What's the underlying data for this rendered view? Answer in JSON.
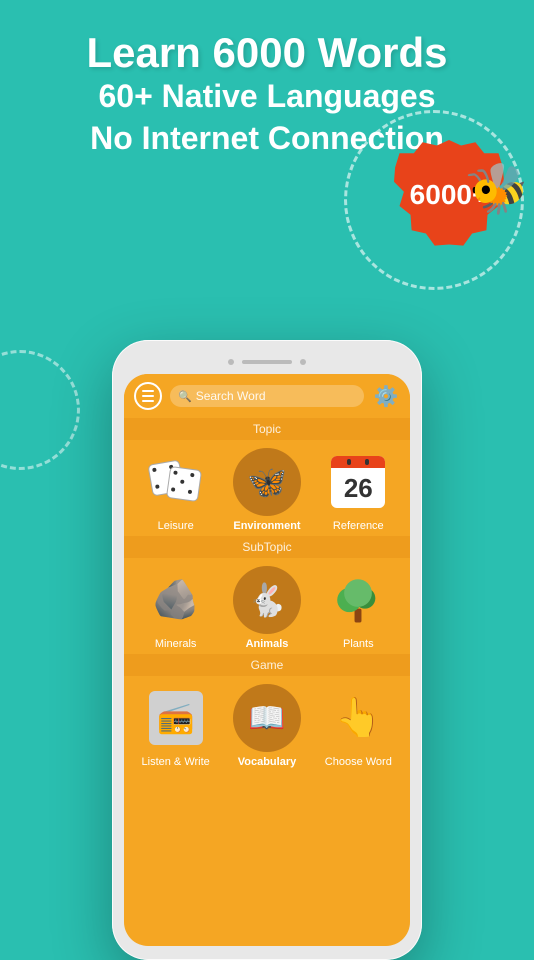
{
  "header": {
    "line1": "Learn  6000 Words",
    "line2": "60+ Native Languages",
    "line3": "No Internet Connection"
  },
  "badge": {
    "label": "6000+"
  },
  "phone": {
    "search_placeholder": "Search Word",
    "sections": [
      {
        "label": "Topic",
        "items": [
          {
            "id": "leisure",
            "label": "Leisure",
            "icon": "dice"
          },
          {
            "id": "environment",
            "label": "Environment",
            "icon": "butterfly",
            "highlighted": true
          },
          {
            "id": "reference",
            "label": "Reference",
            "icon": "calendar",
            "number": "26"
          }
        ]
      },
      {
        "label": "SubTopic",
        "items": [
          {
            "id": "minerals",
            "label": "Minerals",
            "icon": "stones"
          },
          {
            "id": "animals",
            "label": "Animals",
            "icon": "rabbit",
            "highlighted": true
          },
          {
            "id": "plants",
            "label": "Plants",
            "icon": "tree"
          }
        ]
      },
      {
        "label": "Game",
        "items": [
          {
            "id": "listen-write",
            "label": "Listen & Write",
            "icon": "radio"
          },
          {
            "id": "vocabulary",
            "label": "Vocabulary",
            "icon": "book",
            "highlighted": true
          },
          {
            "id": "choose-word",
            "label": "Choose Word",
            "icon": "hand"
          }
        ]
      }
    ]
  }
}
